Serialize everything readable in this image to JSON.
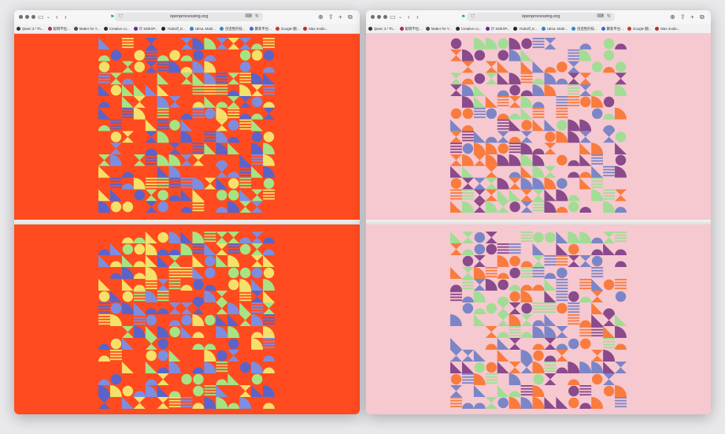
{
  "url": "openprocessing.org",
  "bookmarks": [
    {
      "label": "Qwen 3 / Th...",
      "color": "#333333"
    },
    {
      "label": "聪明不拉...",
      "color": "#aa2a60"
    },
    {
      "label": "Matter for Y...",
      "color": "#4a4a4a"
    },
    {
      "label": "Creative co...",
      "color": "#2c2c2c"
    },
    {
      "label": "计·SDEXP...",
      "color": "#5a2d8a"
    },
    {
      "label": "YtuB1ff_E...",
      "color": "#222222"
    },
    {
      "label": "UEUL Math...",
      "color": "#3a7bd5"
    },
    {
      "label": "创造性的技...",
      "color": "#2a8ad8"
    },
    {
      "label": "聚焦平台...",
      "color": "#3a6ad8"
    },
    {
      "label": "Google 翻...",
      "color": "#d93025"
    },
    {
      "label": "Max mode...",
      "color": "#b03030"
    }
  ],
  "windows": [
    {
      "theme": "orange",
      "background": "#ff4b1f",
      "palette": [
        "#5b63c8",
        "#f5e06a",
        "#a6e383",
        "#7d8ee0",
        "#ff4b1f"
      ],
      "accent": "#2e3d9a"
    },
    {
      "theme": "pink",
      "background": "#f6c8d0",
      "palette": [
        "#8a4a8c",
        "#a2dd96",
        "#7c86c7",
        "#f97c3e",
        "#f6c8d0"
      ],
      "accent": "#6b2d6e"
    }
  ],
  "icons": [
    "sidebar-icon",
    "chevron-down-icon",
    "back-icon",
    "forward-icon",
    "shield-icon",
    "translate-icon",
    "refresh-icon",
    "download-icon",
    "share-icon",
    "new-tab-icon",
    "tabs-overview-icon",
    "favicon-icon"
  ]
}
